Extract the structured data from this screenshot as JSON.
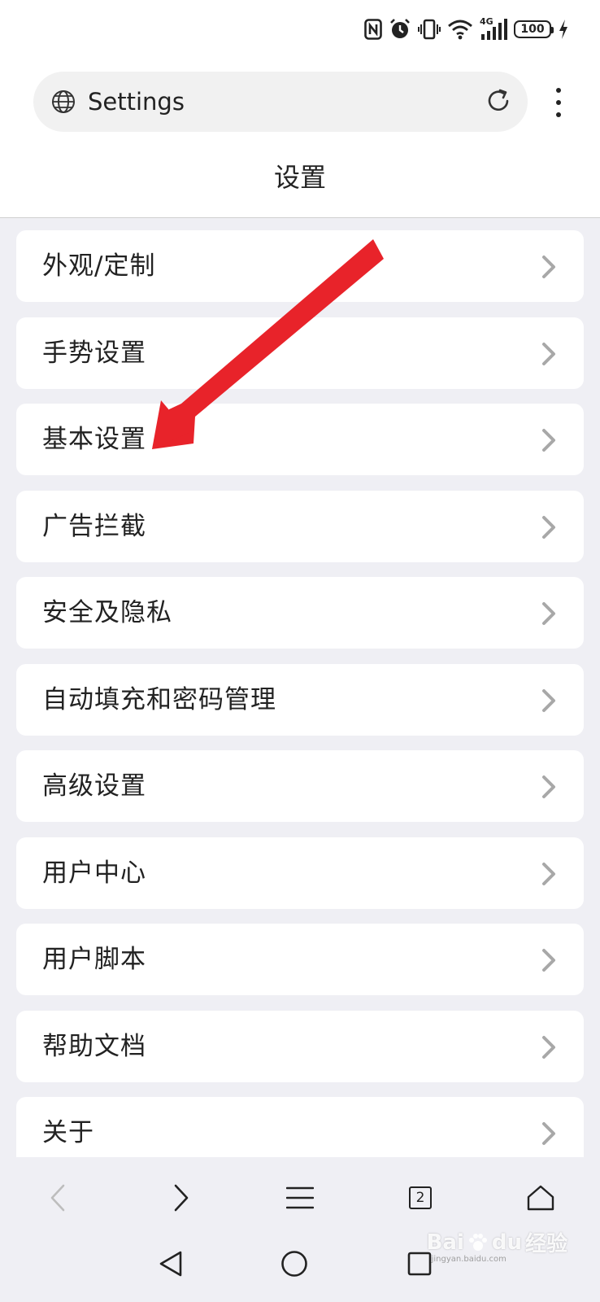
{
  "status_bar": {
    "network_label": "4G",
    "battery_level": "100"
  },
  "browser": {
    "url_text": "Settings"
  },
  "page": {
    "title": "设置"
  },
  "settings": {
    "items": [
      {
        "label": "外观/定制"
      },
      {
        "label": "手势设置"
      },
      {
        "label": "基本设置"
      },
      {
        "label": "广告拦截"
      },
      {
        "label": "安全及隐私"
      },
      {
        "label": "自动填充和密码管理"
      },
      {
        "label": "高级设置"
      },
      {
        "label": "用户中心"
      },
      {
        "label": "用户脚本"
      },
      {
        "label": "帮助文档"
      },
      {
        "label": "关于"
      }
    ]
  },
  "toolbar": {
    "tab_count": "2"
  },
  "watermark": {
    "brand": "Bai",
    "brand_suffix": "du",
    "cn": "经验",
    "url": "jingyan.baidu.com"
  },
  "colors": {
    "annotation_arrow": "#e8232a",
    "list_background": "#efeff4",
    "chevron": "#a8a8a8"
  },
  "icons": {
    "url_bar_left": "globe-icon",
    "url_bar_right": "reload-icon",
    "menu": "more-vertical-icon",
    "row_trailing": "chevron-right-icon"
  }
}
